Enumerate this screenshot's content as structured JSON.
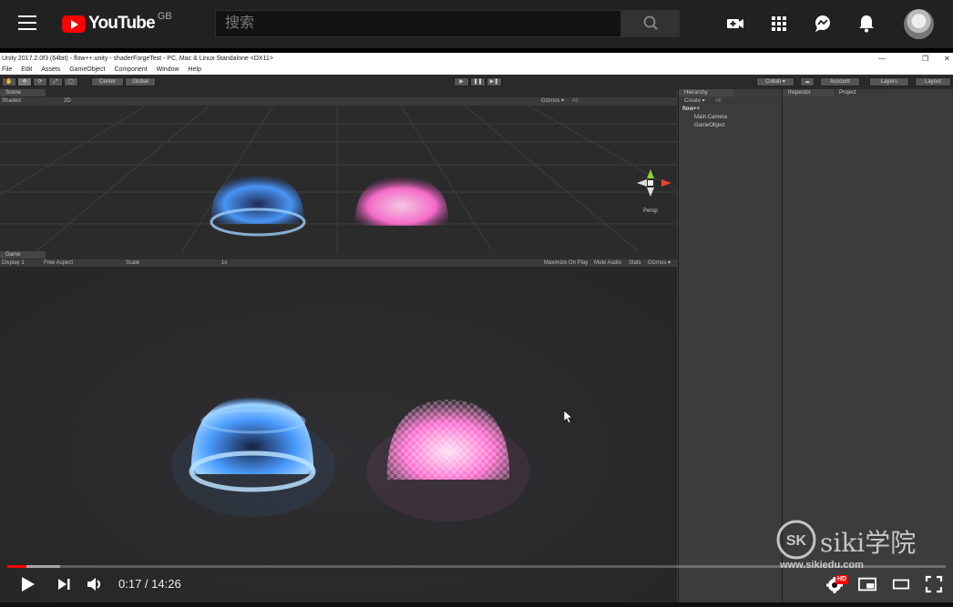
{
  "youtube": {
    "logo_word": "YouTube",
    "region": "GB",
    "search_placeholder": "搜索",
    "icons": [
      "menu-icon",
      "upload-video-icon",
      "apps-icon",
      "messages-icon",
      "notifications-icon"
    ]
  },
  "unity": {
    "window_title": "Unity 2017.2.0f3 (64bit) - flow++.unity - shaderForgeTest - PC, Mac & Linux Standalone <DX11>",
    "menu": [
      "File",
      "Edit",
      "Assets",
      "GameObject",
      "Component",
      "Window",
      "Help"
    ],
    "toolbar": {
      "center": "Center",
      "global": "Global",
      "collab": "Collab ▾",
      "account": "Account",
      "layers": "Layers",
      "layout": "Layout"
    },
    "scene": {
      "tab": "Scene",
      "shading": "Shaded",
      "mode_2d": "2D",
      "gizmos": "Gizmos ▾",
      "search": "All",
      "persp": "Persp"
    },
    "game": {
      "tab": "Game",
      "display": "Display 1",
      "aspect": "Free Aspect",
      "scale_label": "Scale",
      "scale_value": "1x",
      "maximize": "Maximize On Play",
      "mute": "Mute Audio",
      "stats": "Stats",
      "gizmos": "Gizmos ▾"
    },
    "hierarchy": {
      "tab": "Hierarchy",
      "create": "Create ▾",
      "search": "All",
      "scene_name": "flow++",
      "items": [
        "Main Camera",
        "GameObject"
      ]
    },
    "inspector_tab": "Inspector",
    "project_tab": "Project"
  },
  "player": {
    "time": "0:17 / 14:26",
    "progress_fraction": 0.02,
    "buffered_fraction": 0.056,
    "hd_badge": "HD"
  },
  "watermark": {
    "brand": "siki学院",
    "url": "www.sikiedu.com"
  },
  "colors": {
    "youtube_red": "#ff0000",
    "blue_glow": "#4a9bff",
    "pink_glow": "#ff6fd0"
  }
}
